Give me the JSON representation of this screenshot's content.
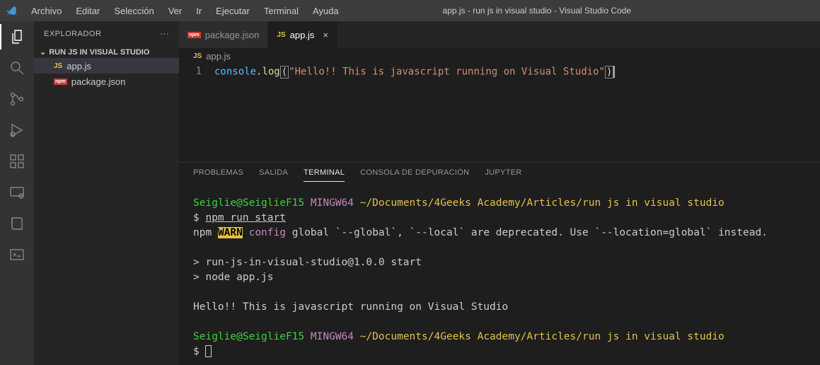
{
  "title": "app.js - run js in visual studio - Visual Studio Code",
  "menu": {
    "archivo": "Archivo",
    "editar": "Editar",
    "seleccion": "Selección",
    "ver": "Ver",
    "ir": "Ir",
    "ejecutar": "Ejecutar",
    "terminal": "Terminal",
    "ayuda": "Ayuda"
  },
  "sidebar": {
    "header": "EXPLORADOR",
    "more": "···",
    "folder": "RUN JS IN VISUAL STUDIO",
    "files": [
      {
        "name": "app.js",
        "icon": "JS"
      },
      {
        "name": "package.json",
        "icon": "npm"
      }
    ]
  },
  "tabs": [
    {
      "icon": "npm",
      "label": "package.json",
      "active": false,
      "close": ""
    },
    {
      "icon": "JS",
      "label": "app.js",
      "active": true,
      "close": "×"
    }
  ],
  "breadcrumb": {
    "icon": "JS",
    "label": "app.js"
  },
  "editor": {
    "lineNumber": "1",
    "code": {
      "obj": "console",
      "dot": ".",
      "method": "log",
      "open": "(",
      "str": "\"Hello!! This is javascript running on Visual Studio\"",
      "close": ")"
    }
  },
  "panel": {
    "tabs": {
      "problemas": "PROBLEMAS",
      "salida": "SALIDA",
      "terminal": "TERMINAL",
      "consola": "CONSOLA DE DEPURACIÓN",
      "jupyter": "JUPYTER"
    }
  },
  "terminal": {
    "user": "Seiglie@SeiglieF15",
    "host": "MINGW64",
    "path": "~/Documents/4Geeks Academy/Articles/run js in visual studio",
    "cmd": "npm run start",
    "line_npm": "npm",
    "warn_tag": "WARN",
    "warn_word": "config",
    "warn_rest": " global `--global`, `--local` are deprecated. Use `--location=global` instead.",
    "start1": "> run-js-in-visual-studio@1.0.0 start",
    "start2": "> node app.js",
    "output": "Hello!! This is javascript running on Visual Studio",
    "prompt": "$"
  }
}
